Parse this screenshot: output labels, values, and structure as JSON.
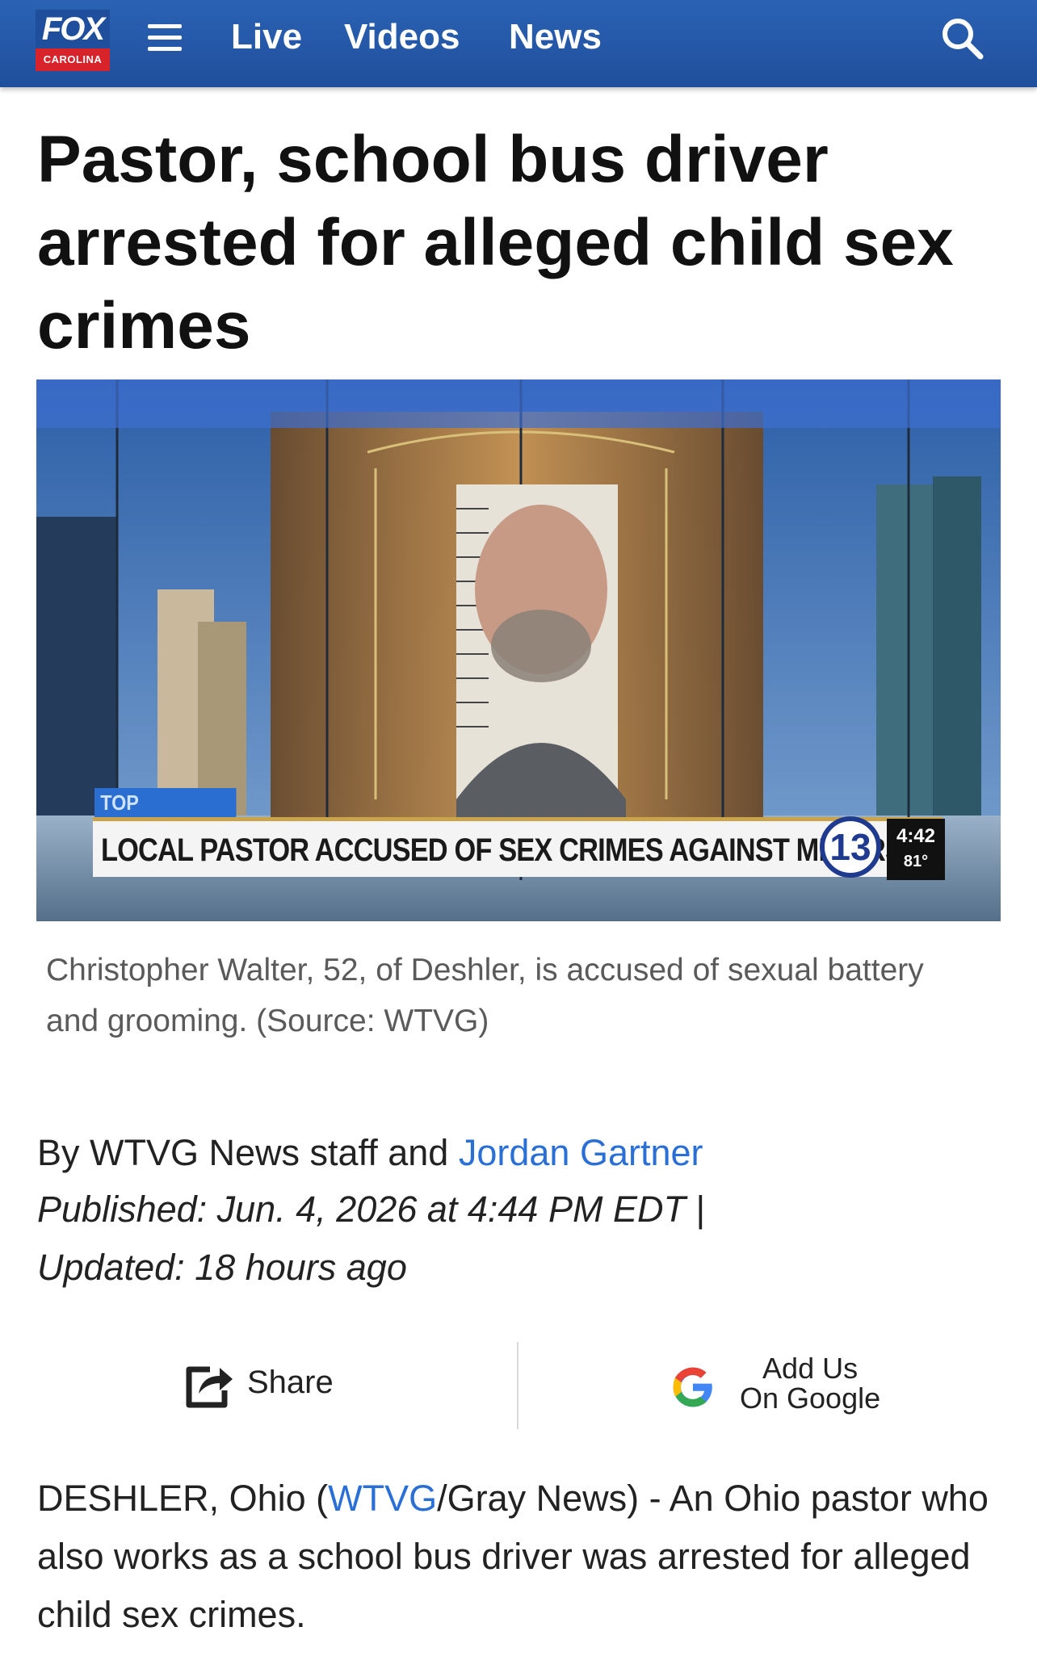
{
  "header": {
    "logo_top": "FOX",
    "logo_bottom": "CAROLINA",
    "nav": [
      {
        "label": "Live"
      },
      {
        "label": "Videos"
      },
      {
        "label": "News"
      }
    ],
    "icons": {
      "menu": "hamburger-menu-icon",
      "search": "search-icon"
    },
    "brand_color": "#2b62b4"
  },
  "article": {
    "headline": "Pastor, school bus driver arrested for alleged child sex crimes",
    "image": {
      "tag_text": "TOP HEADLINES",
      "lower_third": "LOCAL PASTOR ACCUSED OF SEX CRIMES AGAINST MINORS",
      "channel": "13",
      "time": "4:42",
      "temp": "81°"
    },
    "caption": "Christopher Walter, 52, of Deshler, is accused of sexual battery and grooming. (Source: WTVG)",
    "byline_prefix": "By WTVG News staff and ",
    "byline_author": "Jordan Gartner",
    "published": "Published: Jun. 4, 2026 at 4:44 PM EDT",
    "separator": "|",
    "updated": "Updated: 18 hours ago",
    "actions": {
      "share_label": "Share",
      "google_line1": "Add Us",
      "google_line2": "On Google"
    },
    "body_prefix": "DESHLER, Ohio (",
    "body_link": "WTVG",
    "body_suffix": "/Gray News) - An Ohio pastor who also works as a school bus driver was arrested for alleged child sex crimes."
  },
  "colors": {
    "link": "#2a6fd6",
    "caption_gray": "#5a5a5a"
  }
}
